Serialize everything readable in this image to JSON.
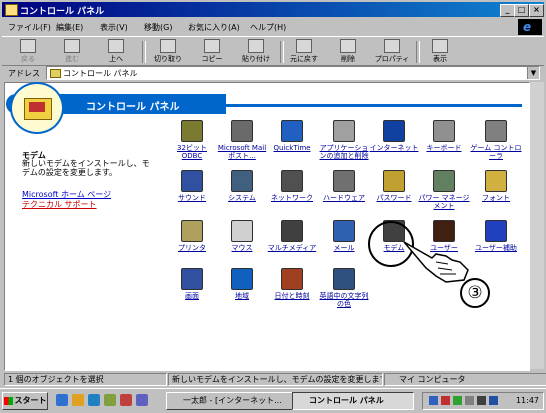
{
  "window": {
    "title": "コントロール パネル",
    "controls": {
      "minimize": "_",
      "maximize": "□",
      "close": "×"
    }
  },
  "menu": {
    "items": [
      "ファイル(F)",
      "編集(E)",
      "表示(V)",
      "移動(G)",
      "お気に入り(A)",
      "ヘルプ(H)"
    ]
  },
  "toolbar": {
    "back": "戻る",
    "forward": "進む",
    "up": "上へ",
    "cut": "切り取り",
    "copy": "コピー",
    "paste": "貼り付け",
    "undo": "元に戻す",
    "delete": "削除",
    "properties": "プロパティ",
    "views": "表示"
  },
  "address": {
    "label": "アドレス",
    "value": "コントロール パネル"
  },
  "left_panel": {
    "banner_title": "コントロール パネル",
    "selected_name": "モデム",
    "selected_desc": "新しいモデムをインストールし、モデムの設定を変更します。",
    "link_home": "Microsoft ホーム ページ",
    "link_support": "テクニカル サポート"
  },
  "icons": [
    {
      "label": "32ビット ODBC",
      "icon": "odbc-icon",
      "color": "#7a7a30"
    },
    {
      "label": "Microsoft Mail ポスト...",
      "icon": "mail-post-icon",
      "color": "#6a6a6a"
    },
    {
      "label": "QuickTime",
      "icon": "quicktime-icon",
      "color": "#2060c0"
    },
    {
      "label": "アプリケーションの追加と削除",
      "icon": "add-remove-icon",
      "color": "#a0a0a0"
    },
    {
      "label": "インターネット",
      "icon": "internet-icon",
      "color": "#1040a0"
    },
    {
      "label": "キーボード",
      "icon": "keyboard-icon",
      "color": "#909090"
    },
    {
      "label": "ゲーム コントローラ",
      "icon": "game-controller-icon",
      "color": "#808080"
    },
    {
      "label": "サウンド",
      "icon": "sound-icon",
      "color": "#3050a0"
    },
    {
      "label": "システム",
      "icon": "system-icon",
      "color": "#406080"
    },
    {
      "label": "ネットワーク",
      "icon": "network-icon",
      "color": "#505050"
    },
    {
      "label": "ハードウェア",
      "icon": "hardware-icon",
      "color": "#707070"
    },
    {
      "label": "パスワード",
      "icon": "password-icon",
      "color": "#c0a030"
    },
    {
      "label": "パワー マネージメント",
      "icon": "power-management-icon",
      "color": "#608060"
    },
    {
      "label": "フォント",
      "icon": "font-icon",
      "color": "#d0b040"
    },
    {
      "label": "プリンタ",
      "icon": "printer-icon",
      "color": "#b0a060"
    },
    {
      "label": "マウス",
      "icon": "mouse-icon",
      "color": "#d0d0d0"
    },
    {
      "label": "マルチメディア",
      "icon": "multimedia-icon",
      "color": "#404040"
    },
    {
      "label": "メール",
      "icon": "mail-icon",
      "color": "#3060b0"
    },
    {
      "label": "モデム",
      "icon": "modem-icon",
      "color": "#404040"
    },
    {
      "label": "ユーザー",
      "icon": "users-icon",
      "color": "#402010"
    },
    {
      "label": "ユーザー補助",
      "icon": "accessibility-icon",
      "color": "#2040c0"
    },
    {
      "label": "画面",
      "icon": "display-icon",
      "color": "#3050a0"
    },
    {
      "label": "地域",
      "icon": "regional-icon",
      "color": "#1060c0"
    },
    {
      "label": "日付と時刻",
      "icon": "date-time-icon",
      "color": "#a04020"
    },
    {
      "label": "英語中の文字列の色",
      "icon": "text-services-icon",
      "color": "#305080"
    }
  ],
  "annotation": {
    "step": "③"
  },
  "status": {
    "count": "1 個のオブジェクトを選択",
    "description": "新しいモデムをインストールし、モデムの設定を変更します。",
    "zone": "マイ コンピュータ"
  },
  "taskbar": {
    "start": "スタート",
    "tasks": [
      "一太郎 - [インターネット...",
      "コントロール パネル"
    ],
    "clock": "11:47"
  }
}
